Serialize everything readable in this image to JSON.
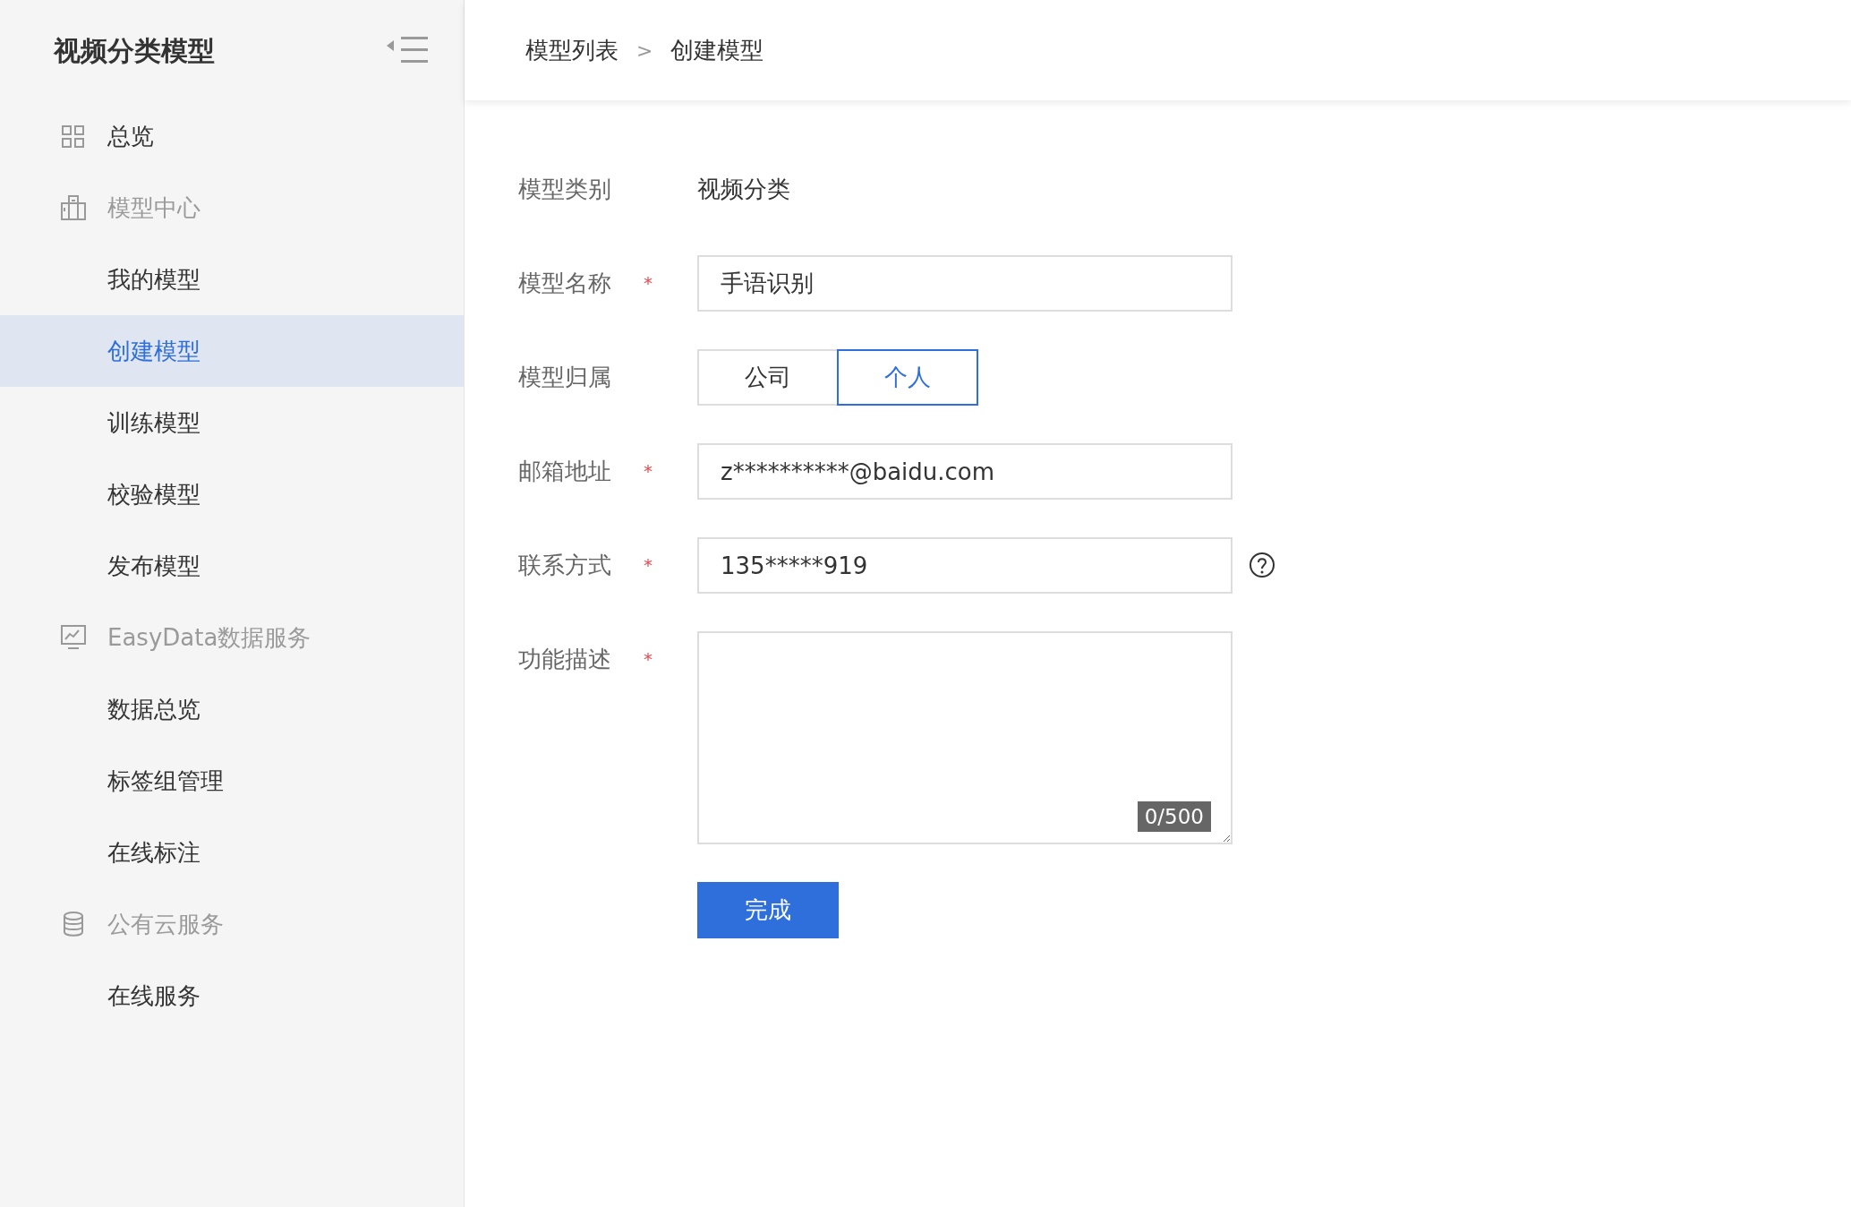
{
  "sidebar": {
    "title": "视频分类模型",
    "items": [
      {
        "kind": "group",
        "label": "总览",
        "selected": false,
        "muted": false
      },
      {
        "kind": "group",
        "label": "模型中心",
        "selected": false,
        "muted": true
      },
      {
        "kind": "link",
        "label": "我的模型",
        "selected": false
      },
      {
        "kind": "link",
        "label": "创建模型",
        "selected": true
      },
      {
        "kind": "link",
        "label": "训练模型",
        "selected": false
      },
      {
        "kind": "link",
        "label": "校验模型",
        "selected": false
      },
      {
        "kind": "link",
        "label": "发布模型",
        "selected": false
      },
      {
        "kind": "group",
        "label": "EasyData数据服务",
        "selected": false,
        "muted": true
      },
      {
        "kind": "link",
        "label": "数据总览",
        "selected": false
      },
      {
        "kind": "link",
        "label": "标签组管理",
        "selected": false
      },
      {
        "kind": "link",
        "label": "在线标注",
        "selected": false
      },
      {
        "kind": "group",
        "label": "公有云服务",
        "selected": false,
        "muted": true
      },
      {
        "kind": "link",
        "label": "在线服务",
        "selected": false
      }
    ]
  },
  "breadcrumb": [
    "模型列表",
    "创建模型"
  ],
  "breadcrumb_separator": ">",
  "form": {
    "fields": [
      {
        "kind": "text",
        "label": "模型类别",
        "value": "视频分类"
      },
      {
        "kind": "input",
        "label": "模型名称",
        "required_mark": "*",
        "value": "手语识别"
      },
      {
        "kind": "segmented",
        "label": "模型归属",
        "options": [
          {
            "label": "公司",
            "selected": false
          },
          {
            "label": "个人",
            "selected": true
          }
        ]
      },
      {
        "kind": "input",
        "label": "邮箱地址",
        "required_mark": "*",
        "value": "z**********@baidu.com"
      },
      {
        "kind": "input",
        "label": "联系方式",
        "required_mark": "*",
        "value": "135*****919",
        "help_icon": true
      },
      {
        "kind": "textarea",
        "label": "功能描述",
        "required_mark": "*",
        "counter": "0/500"
      }
    ],
    "submit": "完成"
  }
}
